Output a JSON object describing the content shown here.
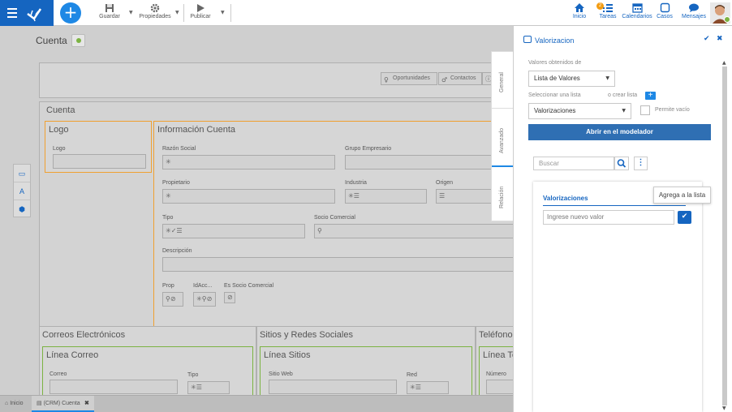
{
  "toolbar": {
    "save_label": "Guardar",
    "properties_label": "Propiedades",
    "publish_label": "Publicar"
  },
  "topnav": {
    "home_label": "Inicio",
    "tasks_label": "Tareas",
    "tasks_badge": "2",
    "calendars_label": "Calendarios",
    "cases_label": "Casos",
    "messages_label": "Mensajes"
  },
  "page": {
    "title": "Cuenta",
    "toolbar_items": [
      "Oportunidades",
      "Contactos"
    ],
    "section_cuenta": "Cuenta",
    "logo_box": {
      "title": "Logo",
      "field_label": "Logo"
    },
    "info_box": {
      "title": "Información Cuenta",
      "fields": {
        "razon_social": "Razón Social",
        "grupo_empresario": "Grupo Empresario",
        "propietario": "Propietario",
        "industria": "Industria",
        "origen": "Origen",
        "tipo": "Tipo",
        "socio_comercial": "Socio Comercial",
        "descripcion": "Descripción",
        "prop": "Prop",
        "idacc": "IdAcc...",
        "es_socio": "Es Socio Comercial"
      }
    },
    "emails": {
      "title": "Correos Electrónicos",
      "sub": "Línea Correo",
      "col1": "Correo",
      "col2": "Tipo"
    },
    "sites": {
      "title": "Sitios y Redes Sociales",
      "sub": "Línea Sitios",
      "col1": "Sitio Web",
      "col2": "Red"
    },
    "phones": {
      "title": "Teléfonos",
      "sub": "Línea Te",
      "col1": "Número"
    }
  },
  "tabs": {
    "home": "Inicio",
    "current": "(CRM) Cuenta"
  },
  "side_tabs": {
    "general": "General",
    "advanced": "Avanzado",
    "relation": "Relación"
  },
  "panel": {
    "title": "Valorizacion",
    "values_from_label": "Valores obtenidos de",
    "values_from_value": "Lista de Valores",
    "select_list_label": "Seleccionar una lista",
    "create_list_label": "o crear lista",
    "selected_list": "Valorizaciones",
    "allow_empty_label": "Permite vacío",
    "open_modeler_label": "Abrir en el modelador",
    "search_placeholder": "Buscar",
    "list_title": "Valorizaciones",
    "new_value_placeholder": "Ingrese nuevo valor",
    "tooltip": "Agrega a la lista"
  },
  "colors": {
    "primary": "#1565c0",
    "accent": "#1e88e5",
    "highlight_border": "#f0a030",
    "green": "#7cb342"
  },
  "icons": [
    "menu-icon",
    "logo-icon",
    "plus-icon",
    "save-icon",
    "gear-icon",
    "play-icon",
    "home-icon",
    "tasks-icon",
    "calendar-icon",
    "cases-icon",
    "chat-icon",
    "search-icon",
    "check-icon",
    "close-icon",
    "kebab-icon"
  ]
}
